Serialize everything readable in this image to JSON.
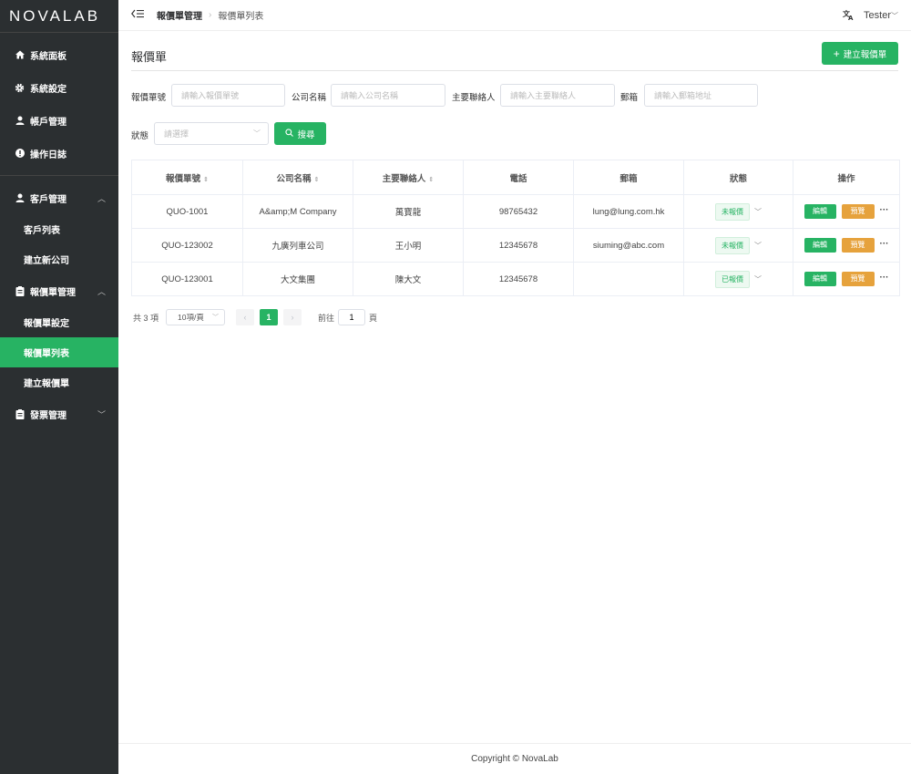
{
  "brand": {
    "logo": "NOVALAB"
  },
  "sidebar": {
    "items": [
      {
        "label": "系統面板",
        "icon": "home-icon"
      },
      {
        "label": "系統設定",
        "icon": "gear-icon"
      },
      {
        "label": "帳戶管理",
        "icon": "user-icon"
      },
      {
        "label": "操作日誌",
        "icon": "alert-icon"
      }
    ],
    "customer": {
      "label": "客戶管理",
      "icon": "user-icon",
      "subs": [
        "客戶列表",
        "建立新公司"
      ]
    },
    "quotation": {
      "label": "報價單管理",
      "icon": "clipboard-icon",
      "subs": [
        "報價單設定",
        "報價單列表",
        "建立報價單"
      ]
    },
    "invoice": {
      "label": "發票管理",
      "icon": "clipboard-icon"
    }
  },
  "header": {
    "breadcrumb_parent": "報價單管理",
    "breadcrumb_current": "報價單列表",
    "user": "Tester"
  },
  "page": {
    "title": "報價單",
    "add_button": "建立報價單"
  },
  "filters": {
    "quote_no": {
      "label": "報價單號",
      "placeholder": "請輸入報價單號"
    },
    "company": {
      "label": "公司名稱",
      "placeholder": "請輸入公司名稱"
    },
    "contact": {
      "label": "主要聯絡人",
      "placeholder": "請輸入主要聯絡人"
    },
    "email": {
      "label": "郵箱",
      "placeholder": "請輸入郵箱地址"
    },
    "status": {
      "label": "狀態",
      "placeholder": "請選擇"
    },
    "search_button": "搜尋"
  },
  "table": {
    "columns": [
      "報價單號",
      "公司名稱",
      "主要聯絡人",
      "電話",
      "郵箱",
      "狀態",
      "操作"
    ],
    "rows": [
      {
        "quote_no": "QUO-1001",
        "company": "A&amp;M Company",
        "contact": "萬寶龍",
        "phone": "98765432",
        "email": "lung@lung.com.hk",
        "status": "未報價"
      },
      {
        "quote_no": "QUO-123002",
        "company": "九廣列車公司",
        "contact": "王小明",
        "phone": "12345678",
        "email": "siuming@abc.com",
        "status": "未報價"
      },
      {
        "quote_no": "QUO-123001",
        "company": "大文集團",
        "contact": "陳大文",
        "phone": "12345678",
        "email": "",
        "status": "已報價"
      }
    ],
    "edit_label": "編輯",
    "preview_label": "預覽",
    "more_label": "···"
  },
  "pagination": {
    "total": "共 3 項",
    "page_size": "10項/頁",
    "current_page": "1",
    "goto_prefix": "前往",
    "goto_value": "1",
    "goto_suffix": "頁"
  },
  "footer": {
    "copyright": "Copyright © NovaLab"
  },
  "colors": {
    "primary": "#27b363",
    "warning": "#e6a23c",
    "sidebar_bg": "#2b2f31"
  }
}
